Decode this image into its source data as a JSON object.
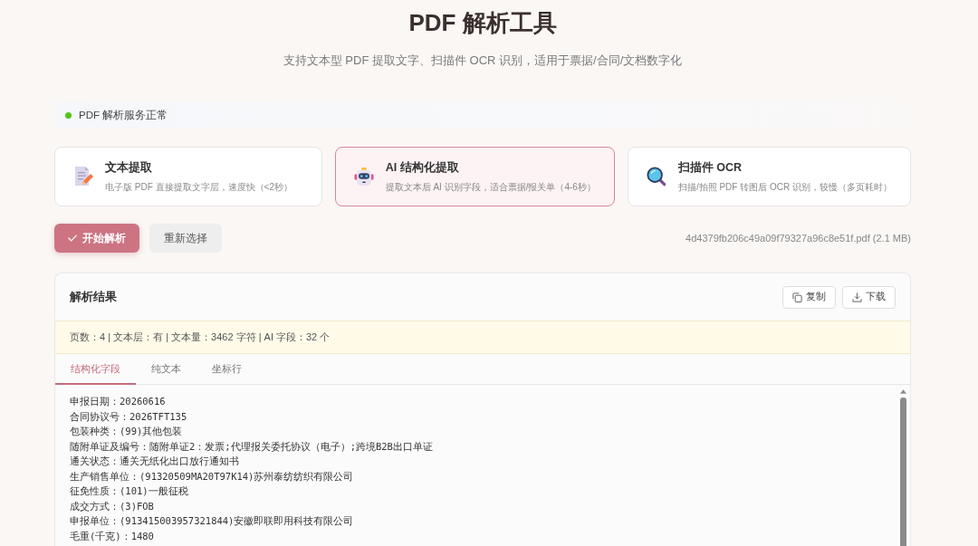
{
  "title": "PDF 解析工具",
  "subtitle": "支持文本型 PDF 提取文字、扫描件 OCR 识别，适用于票据/合同/文档数字化",
  "status": {
    "text": "PDF 解析服务正常",
    "healthy": true
  },
  "modes": [
    {
      "kind": "text",
      "title": "文本提取",
      "description": "电子版 PDF 直接提取文字层，速度快（<2秒）",
      "selected": false
    },
    {
      "kind": "ai",
      "title": "AI 结构化提取",
      "description": "提取文本后 AI 识别字段，适合票据/报关单（4-6秒）",
      "selected": true
    },
    {
      "kind": "ocr",
      "title": "扫描件 OCR",
      "description": "扫描/拍照 PDF 转图后 OCR 识别，较慢（多页耗时）",
      "selected": false
    }
  ],
  "actions": {
    "start": "开始解析",
    "reset": "重新选择"
  },
  "file": "4d4379fb206c49a09f79327a96c8e51f.pdf (2.1 MB)",
  "results": {
    "title": "解析结果",
    "tools": [
      {
        "kind": "copy",
        "label": "复制"
      },
      {
        "kind": "download",
        "label": "下载"
      }
    ],
    "summary": "页数：4 | 文本层：有 | 文本量：3462 字符 | AI 字段：32 个",
    "tabs": [
      {
        "label": "结构化字段",
        "selected": true
      },
      {
        "label": "纯文本",
        "selected": false
      },
      {
        "label": "坐标行",
        "selected": false
      }
    ],
    "lines": [
      "申报日期：20260616",
      "合同协议号：2026TFT135",
      "包装种类：(99)其他包装",
      "随附单证及编号：随附单证2：发票;代理报关委托协议（电子）;跨境B2B出口单证",
      "通关状态：通关无纸化出口放行通知书",
      "生产销售单位：(91320509MA20T97K14)苏州泰纺纺织有限公司",
      "征免性质：(101)一般征税",
      "成交方式：(3)FOB",
      "申报单位：(913415003957321844)安徽即联即用科技有限公司",
      "毛重(千克)：1480"
    ]
  }
}
